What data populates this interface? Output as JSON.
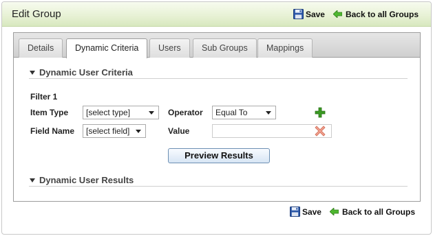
{
  "header": {
    "title": "Edit Group"
  },
  "actions": {
    "save_label": "Save",
    "back_label": "Back to all Groups",
    "save_icon": "floppy-disk-icon",
    "back_icon": "green-left-arrow-icon"
  },
  "tabs": [
    {
      "label": "Details",
      "active": false
    },
    {
      "label": "Dynamic Criteria",
      "active": true
    },
    {
      "label": "Users",
      "active": false
    },
    {
      "label": "Sub Groups",
      "active": false
    },
    {
      "label": "Mappings",
      "active": false
    }
  ],
  "criteria": {
    "section_title": "Dynamic User Criteria",
    "filter_title": "Filter 1",
    "item_type_label": "Item Type",
    "item_type_value": "[select type]",
    "operator_label": "Operator",
    "operator_value": "Equal To",
    "field_name_label": "Field Name",
    "field_name_value": "[select field]",
    "value_label": "Value",
    "value_value": "",
    "add_icon": "green-plus-icon",
    "remove_icon": "red-x-icon",
    "preview_label": "Preview Results"
  },
  "results": {
    "section_title": "Dynamic User Results"
  },
  "colors": {
    "title_bar": "#e8f2d6",
    "add": "#3a9a22",
    "remove": "#e8806a",
    "button_border": "#6c8fb3"
  }
}
